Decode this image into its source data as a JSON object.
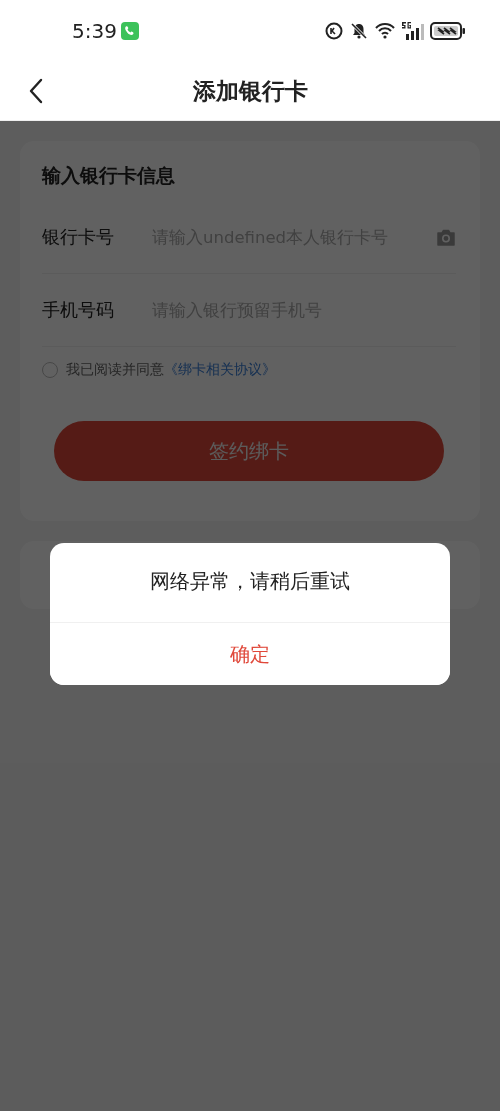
{
  "status_bar": {
    "time": "5:39"
  },
  "nav": {
    "title": "添加银行卡"
  },
  "form": {
    "title": "输入银行卡信息",
    "fields": [
      {
        "label": "银行卡号",
        "placeholder": "请输入undefined本人银行卡号",
        "kind": "camera"
      },
      {
        "label": "手机号码",
        "placeholder": "请输入银行预留手机号",
        "kind": "plain"
      }
    ],
    "agreement": {
      "checked": false,
      "text": "我已阅读并同意",
      "link": "《绑卡相关协议》"
    },
    "submit": "签约绑卡"
  },
  "dialog": {
    "message": "网络异常，请稍后重试",
    "button": "确定"
  }
}
